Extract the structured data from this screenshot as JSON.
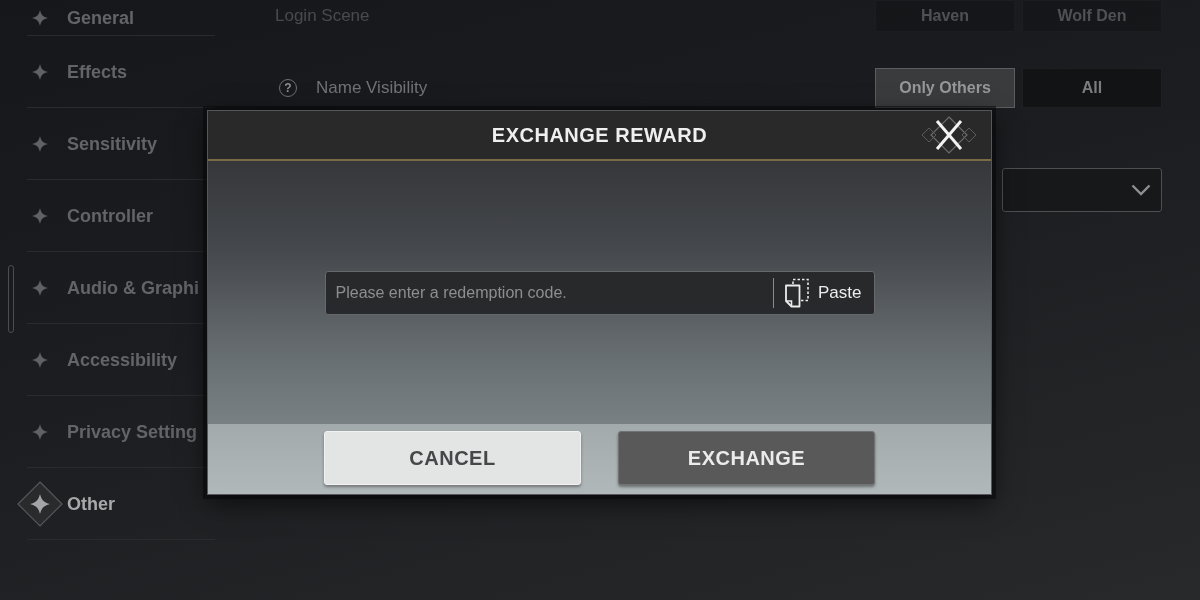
{
  "sidebar": {
    "items": [
      {
        "label": "General",
        "selected": false
      },
      {
        "label": "Effects",
        "selected": false
      },
      {
        "label": "Sensitivity",
        "selected": false
      },
      {
        "label": "Controller",
        "selected": false
      },
      {
        "label": "Audio & Graphi",
        "selected": false
      },
      {
        "label": "Accessibility",
        "selected": false
      },
      {
        "label": "Privacy Setting",
        "selected": false
      },
      {
        "label": "Other",
        "selected": true
      }
    ]
  },
  "settings": {
    "rows": [
      {
        "kind": "segmented",
        "label": "Login Scene",
        "options": [
          {
            "label": "Haven",
            "selected": false
          },
          {
            "label": "Wolf Den",
            "selected": false
          }
        ]
      },
      {
        "kind": "segmented",
        "help": "?",
        "label": "Name Visibility",
        "options": [
          {
            "label": "Only Others",
            "selected": true
          },
          {
            "label": "All",
            "selected": false
          }
        ]
      },
      {
        "kind": "dropdown"
      }
    ]
  },
  "dialog": {
    "title": "EXCHANGE REWARD",
    "code_field": {
      "placeholder": "Please enter a redemption code.",
      "paste_label": "Paste"
    },
    "buttons": [
      {
        "kind": "secondary",
        "label": "CANCEL"
      },
      {
        "kind": "primary",
        "label": "EXCHANGE"
      }
    ]
  }
}
